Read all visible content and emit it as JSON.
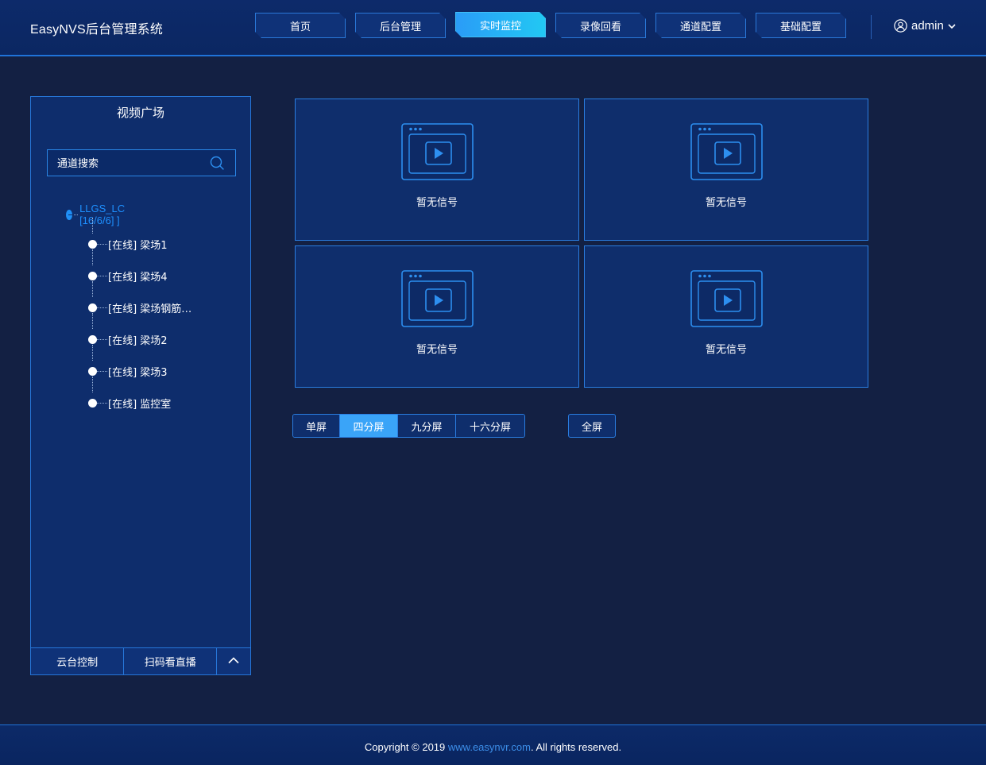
{
  "header": {
    "brand": "EasyNVS后台管理系统",
    "nav": [
      {
        "label": "首页",
        "active": false
      },
      {
        "label": "后台管理",
        "active": false
      },
      {
        "label": "实时监控",
        "active": true
      },
      {
        "label": "录像回看",
        "active": false
      },
      {
        "label": "通道配置",
        "active": false
      },
      {
        "label": "基础配置",
        "active": false
      }
    ],
    "user": "admin"
  },
  "sidebar": {
    "title": "视频广场",
    "search_placeholder": "通道搜索",
    "root": "LLGS_LC [16/6/6] ]",
    "channels": [
      "[在线] 梁场1",
      "[在线] 梁场4",
      "[在线] 梁场钢筋…",
      "[在线] 梁场2",
      "[在线] 梁场3",
      "[在线] 监控室"
    ],
    "footer": {
      "ptz": "云台控制",
      "qrcode": "扫码看直播"
    }
  },
  "grid": {
    "cells": [
      "暂无信号",
      "暂无信号",
      "暂无信号",
      "暂无信号"
    ]
  },
  "splits": {
    "options": [
      "单屏",
      "四分屏",
      "九分屏",
      "十六分屏"
    ],
    "active_index": 1,
    "fullscreen": "全屏"
  },
  "footer": {
    "prefix": "Copyright © 2019 ",
    "link": "www.easynvr.com",
    "suffix": ". All rights reserved."
  },
  "colors": {
    "background": "#132043",
    "accent": "#1e90ff",
    "active_tab": "#2a9cf7"
  }
}
